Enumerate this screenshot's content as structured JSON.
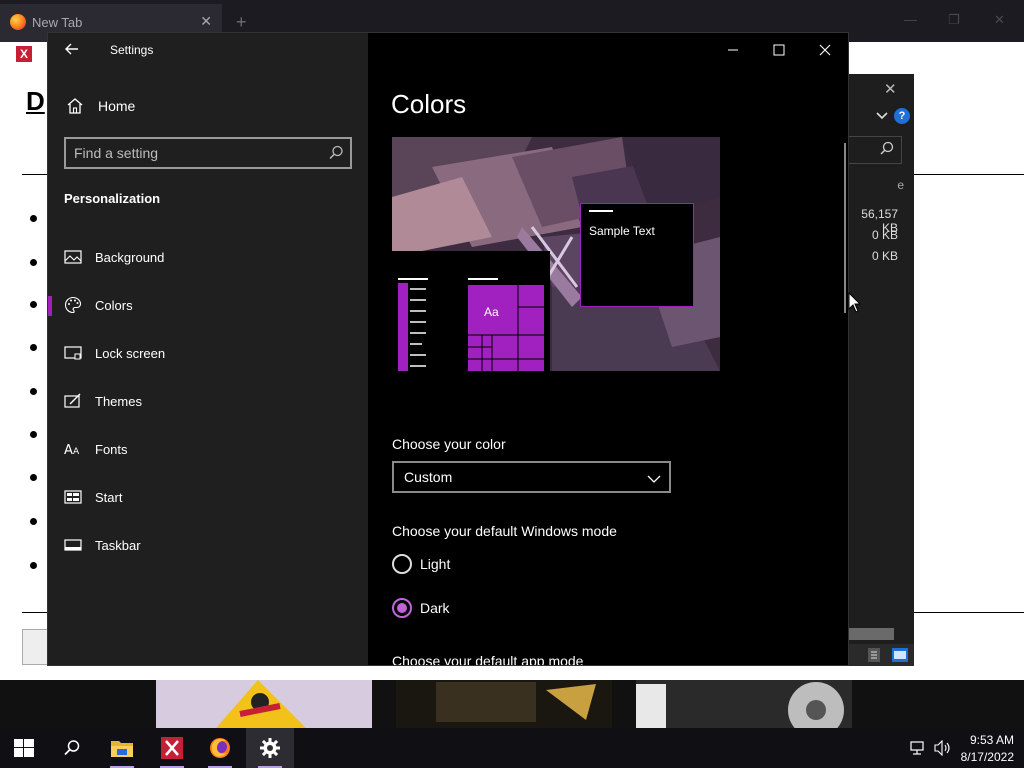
{
  "browser": {
    "tab_title": "New Tab",
    "tab_close": "✕",
    "new_tab": "+",
    "page_favicon": "X",
    "page_heading": "D"
  },
  "explorer": {
    "close": "✕",
    "help": "?",
    "header_fragment": "e",
    "sizes": [
      "56,157 KB",
      "0 KB",
      "0 KB"
    ]
  },
  "settings": {
    "app_title": "Settings",
    "home_label": "Home",
    "search_placeholder": "Find a setting",
    "section_title": "Personalization",
    "nav_items": [
      {
        "label": "Background",
        "icon": "picture-icon"
      },
      {
        "label": "Colors",
        "icon": "palette-icon"
      },
      {
        "label": "Lock screen",
        "icon": "lock-screen-icon"
      },
      {
        "label": "Themes",
        "icon": "themes-icon"
      },
      {
        "label": "Fonts",
        "icon": "fonts-icon"
      },
      {
        "label": "Start",
        "icon": "start-icon"
      },
      {
        "label": "Taskbar",
        "icon": "taskbar-icon"
      }
    ],
    "active_item": "Colors",
    "page_title": "Colors",
    "preview": {
      "sample_text": "Sample Text",
      "tile_label": "Aa"
    },
    "choose_color_label": "Choose your color",
    "color_value": "Custom",
    "windows_mode_label": "Choose your default Windows mode",
    "windows_mode_options": [
      "Light",
      "Dark"
    ],
    "windows_mode_selected": "Dark",
    "app_mode_label": "Choose your default app mode",
    "accent_color": "#a020c0"
  },
  "taskbar": {
    "time": "9:53 AM",
    "date": "8/17/2022"
  }
}
